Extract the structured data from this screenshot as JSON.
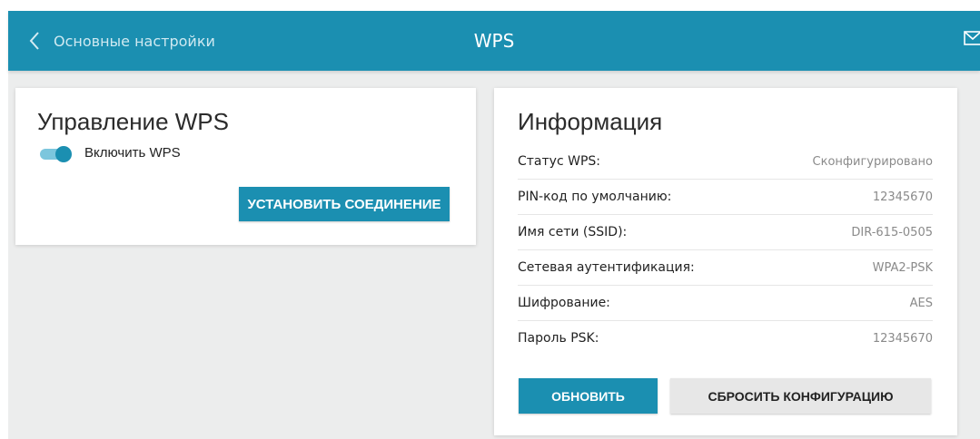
{
  "header": {
    "back_label": "Основные настройки",
    "title": "WPS",
    "icons": {
      "back": "chevron-left-icon",
      "mail": "mail-icon"
    }
  },
  "wps_card": {
    "title": "Управление WPS",
    "toggle": {
      "label": "Включить WPS",
      "checked": true
    },
    "connect_button": "УСТАНОВИТЬ СОЕДИНЕНИЕ"
  },
  "info_card": {
    "title": "Информация",
    "rows": [
      {
        "label": "Статус WPS:",
        "value": "Сконфигурировано"
      },
      {
        "label": "PIN-код по умолчанию:",
        "value": "12345670"
      },
      {
        "label": "Имя сети (SSID):",
        "value": "DIR-615-0505"
      },
      {
        "label": "Сетевая аутентификация:",
        "value": "WPA2-PSK"
      },
      {
        "label": "Шифрование:",
        "value": "AES"
      },
      {
        "label": "Пароль PSK:",
        "value": "12345670"
      }
    ],
    "refresh_button": "ОБНОВИТЬ",
    "reset_button": "СБРОСИТЬ КОНФИГУРАЦИЮ"
  },
  "colors": {
    "accent": "#1b8fb1",
    "toggle_track": "#7cc6dd",
    "background": "#eceded",
    "secondary_button": "#e7e7e7"
  }
}
